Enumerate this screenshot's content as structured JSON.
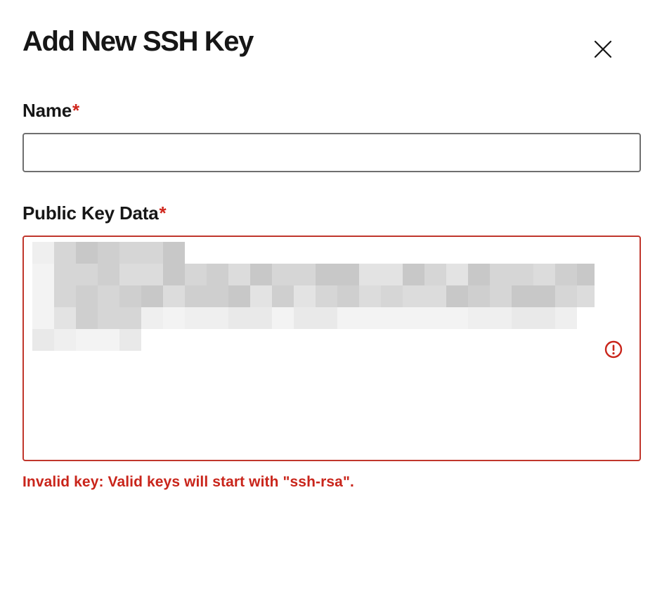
{
  "dialog": {
    "title": "Add New SSH Key",
    "close_icon": "close-icon"
  },
  "form": {
    "name": {
      "label": "Name",
      "required_marker": "*",
      "value": "",
      "placeholder": ""
    },
    "public_key": {
      "label": "Public Key Data",
      "required_marker": "*",
      "content_state": "redacted/pixelated",
      "error_icon": "alert-circle-icon",
      "error_message": "Invalid key: Valid keys will start with \"ssh-rsa\"."
    }
  },
  "colors": {
    "text": "#161616",
    "required": "#d0271d",
    "error": "#c9251b",
    "error_border": "#c0362c",
    "input_border": "#6f6f6f"
  }
}
